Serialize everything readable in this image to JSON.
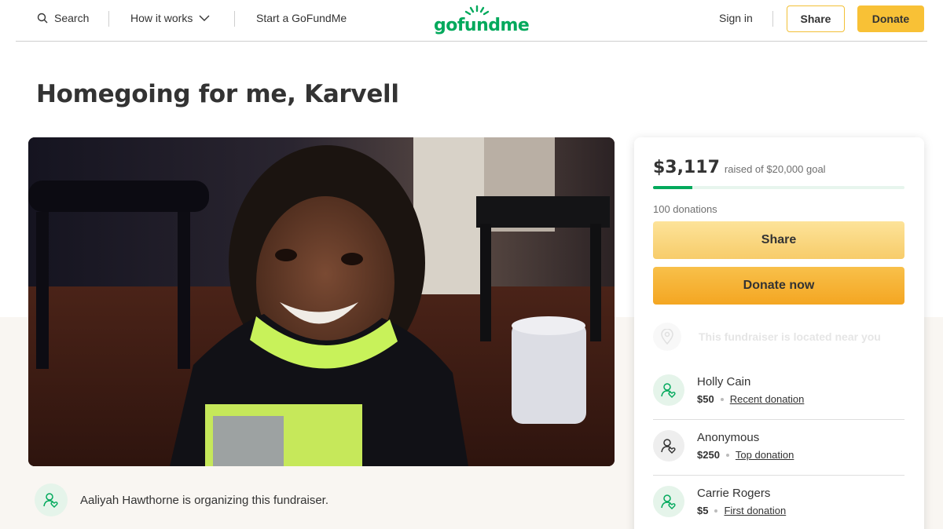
{
  "nav": {
    "search_label": "Search",
    "how_it_works_label": "How it works",
    "start_label": "Start a GoFundMe",
    "logo_text": "gofundme",
    "signin_label": "Sign in",
    "share_label": "Share",
    "donate_label": "Donate"
  },
  "page": {
    "title": "Homegoing for me, Karvell"
  },
  "organizer": {
    "text": "Aaliyah Hawthorne is organizing this fundraiser."
  },
  "fundraiser": {
    "amount_raised": "$3,117",
    "goal_text": "raised of $20,000 goal",
    "progress_fraction": 0.156,
    "donations_count": "100 donations",
    "share_label": "Share",
    "donate_label": "Donate now",
    "location_text": "This fundraiser is located near you"
  },
  "donors": [
    {
      "name": "Holly Cain",
      "amount": "$50",
      "tag": "Recent donation"
    },
    {
      "name": "Anonymous",
      "amount": "$250",
      "tag": "Top donation"
    },
    {
      "name": "Carrie Rogers",
      "amount": "$5",
      "tag": "First donation"
    }
  ],
  "colors": {
    "brand_green": "#02a95c",
    "accent_yellow": "#f8c136",
    "band_beige": "#f9f6f2"
  }
}
